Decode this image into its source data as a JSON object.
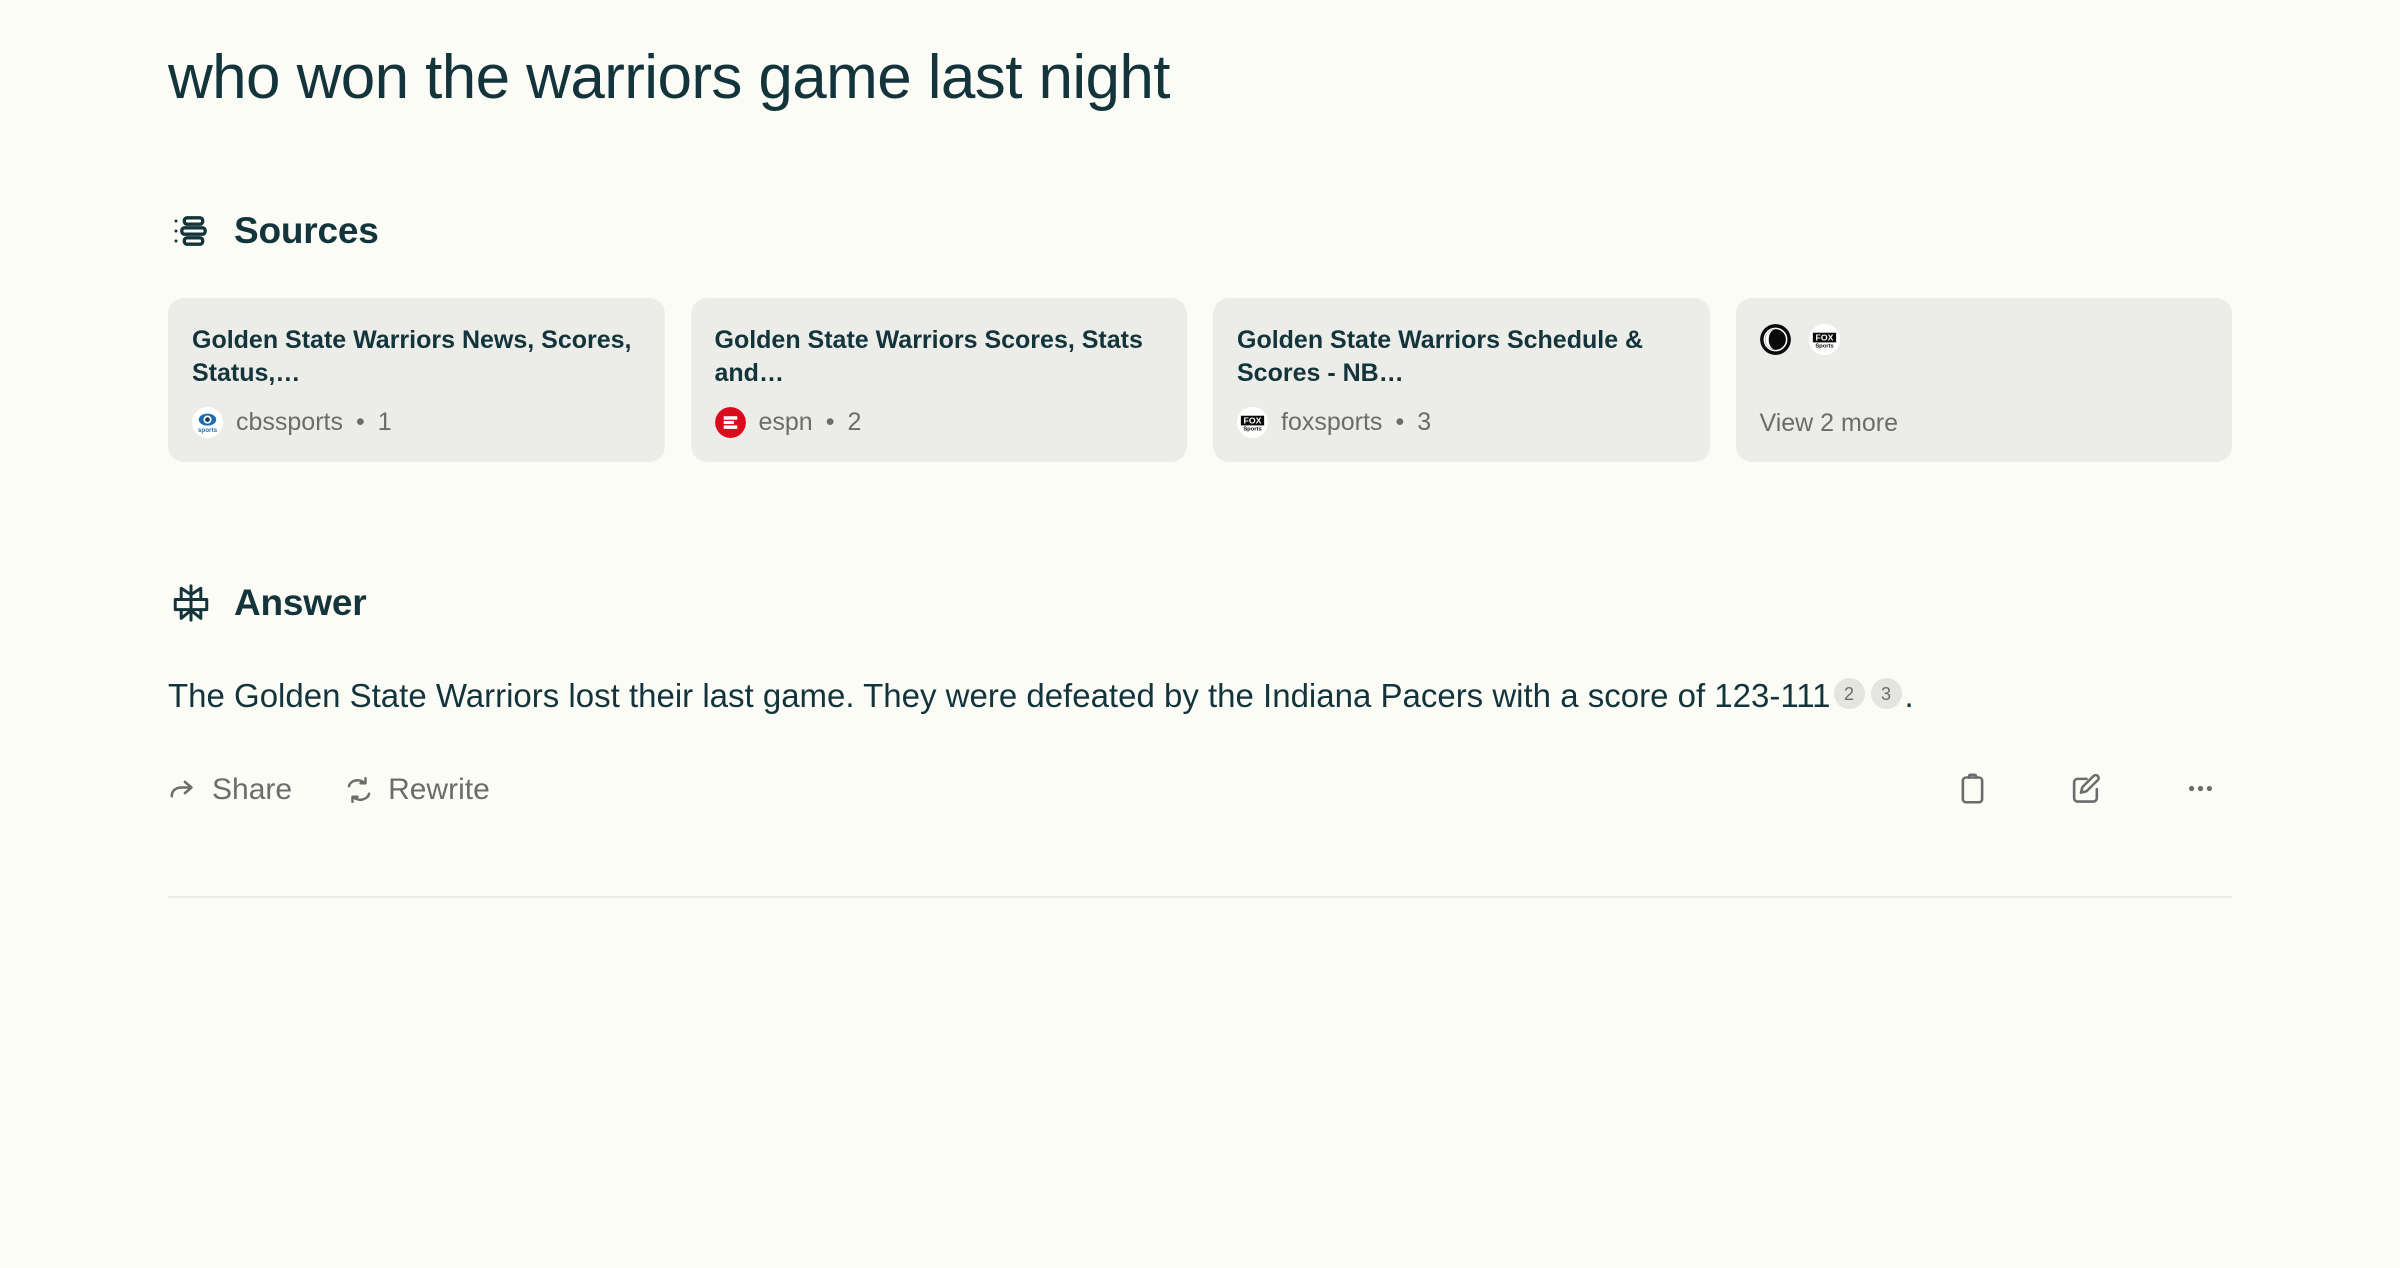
{
  "query": {
    "title": "who won the warriors game last night"
  },
  "sources": {
    "heading": "Sources",
    "icon": "sources-list-icon",
    "cards": [
      {
        "title": "Golden State Warriors News, Scores, Status,…",
        "domain": "cbssports",
        "index": "1",
        "favicon": "cbssports-favicon",
        "separator": "•"
      },
      {
        "title": "Golden State Warriors Scores, Stats and…",
        "domain": "espn",
        "index": "2",
        "favicon": "espn-favicon",
        "separator": "•"
      },
      {
        "title": "Golden State Warriors Schedule & Scores - NB…",
        "domain": "foxsports",
        "index": "3",
        "favicon": "foxsports-favicon",
        "separator": "•"
      }
    ],
    "more_card": {
      "label": "View 2 more",
      "icons": [
        "cbs-circle-favicon",
        "foxsports-favicon"
      ]
    }
  },
  "answer": {
    "heading": "Answer",
    "icon": "perplexity-logo-icon",
    "text_part_1": "The Golden State Warriors lost their last game. They were defeated by the Indiana Pacers with a score of 123-111",
    "citations": [
      "2",
      "3"
    ],
    "text_part_2": "."
  },
  "actions": {
    "share_label": "Share",
    "rewrite_label": "Rewrite",
    "copy_icon": "clipboard-icon",
    "edit_icon": "pencil-square-icon",
    "more_icon": "ellipsis-icon"
  },
  "colors": {
    "page_background": "#FCFCF7",
    "card_background": "#ECEDE8",
    "text_primary": "#13343B",
    "text_muted": "#6C6C6C",
    "citation_background": "#E4E4E0",
    "espn_red": "#DA0B1D",
    "cbs_blue": "#1C6CB0",
    "divider": "#EDEDE7"
  }
}
